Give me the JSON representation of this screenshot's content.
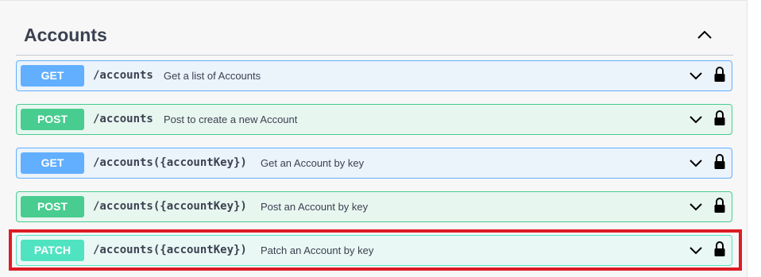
{
  "section": {
    "title": "Accounts",
    "collapse_icon": "chevron-up-icon"
  },
  "colors": {
    "get": "#61affe",
    "post": "#49cc90",
    "patch": "#50e3c2",
    "highlight": "#dc1c24"
  },
  "operations": [
    {
      "method": "GET",
      "path": "/accounts",
      "summary": "Get a list of Accounts"
    },
    {
      "method": "POST",
      "path": "/accounts",
      "summary": "Post to create a new Account"
    },
    {
      "method": "GET",
      "path": "/accounts({accountKey})",
      "summary": "Get an Account by key"
    },
    {
      "method": "POST",
      "path": "/accounts({accountKey})",
      "summary": "Post an Account by key"
    },
    {
      "method": "PATCH",
      "path": "/accounts({accountKey})",
      "summary": "Patch an Account by key"
    }
  ],
  "icons": {
    "expand": "chevron-down-icon",
    "auth": "lock-icon"
  }
}
